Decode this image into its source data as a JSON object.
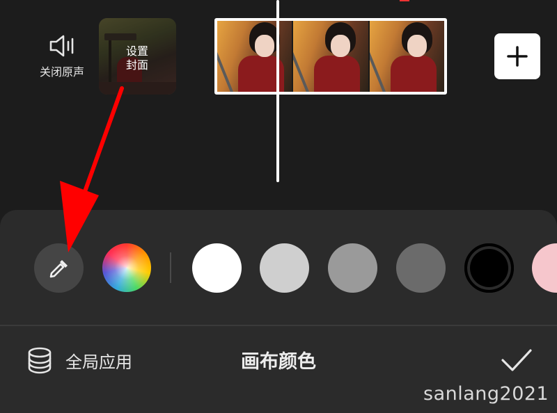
{
  "timeline": {
    "mute_label": "关闭原声",
    "cover_label_line1": "设置",
    "cover_label_line2": "封面",
    "add_icon": "plus-icon"
  },
  "color_panel": {
    "title": "画布颜色",
    "apply_all_label": "全局应用",
    "swatches": [
      "#ffffff",
      "#cfcfcf",
      "#9a9a9a",
      "#6b6b6b",
      "#000000",
      "#f6c6cc"
    ],
    "icons": [
      "eyedropper-icon",
      "color-spectrum-icon",
      "layers-icon",
      "checkmark-icon"
    ]
  },
  "watermark": "sanlang2021",
  "annotation": {
    "arrow_color": "#ff0000"
  }
}
